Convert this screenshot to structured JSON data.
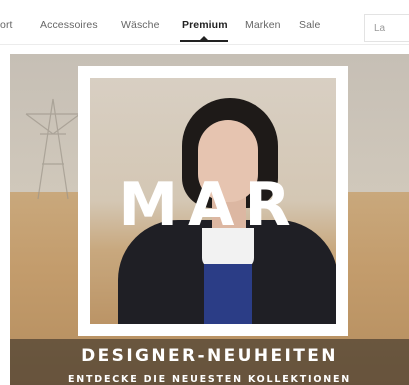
{
  "nav": {
    "items": [
      {
        "label": "ort",
        "active": false
      },
      {
        "label": "Accessoires",
        "active": false
      },
      {
        "label": "Wäsche",
        "active": false
      },
      {
        "label": "Premium",
        "active": true
      },
      {
        "label": "Marken",
        "active": false
      },
      {
        "label": "Sale",
        "active": false
      }
    ],
    "side_label": "La"
  },
  "hero": {
    "word": "MAR",
    "headline": "DESIGNER-NEUHEITEN",
    "subline": "ENTDECKE DIE NEUESTEN KOLLEKTIONEN"
  },
  "colors": {
    "nav_text": "#666666",
    "nav_active": "#222222",
    "frame": "#ffffff"
  }
}
